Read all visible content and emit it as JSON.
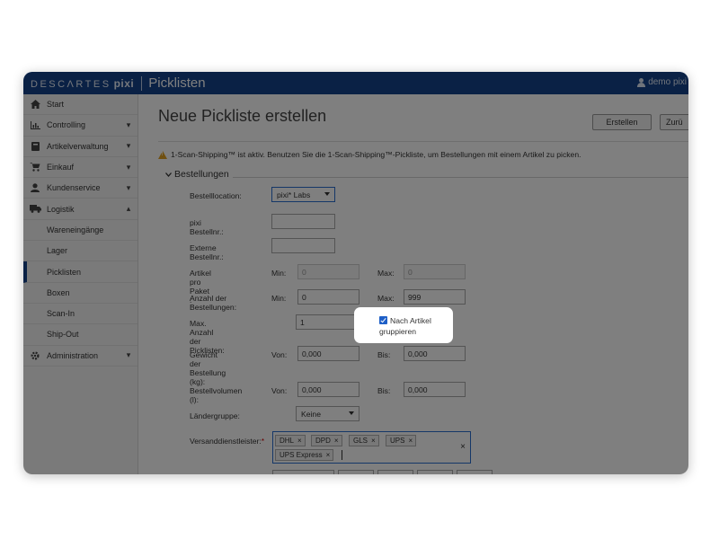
{
  "topbar": {
    "brand": "DESCΛRTES",
    "brand_pixi": "pixi",
    "app_title": "Picklisten",
    "user": "demo pixi"
  },
  "sidebar": {
    "items": [
      {
        "label": "Start",
        "icon": "home-icon",
        "chevron": ""
      },
      {
        "label": "Controlling",
        "icon": "bar-chart-icon",
        "chevron": "▾"
      },
      {
        "label": "Artikelverwaltung",
        "icon": "book-icon",
        "chevron": "▾"
      },
      {
        "label": "Einkauf",
        "icon": "cart-icon",
        "chevron": "▾"
      },
      {
        "label": "Kundenservice",
        "icon": "user-icon",
        "chevron": "▾"
      },
      {
        "label": "Logistik",
        "icon": "truck-icon",
        "chevron": "▴"
      },
      {
        "label": "Wareneingänge",
        "sub": true
      },
      {
        "label": "Lager",
        "sub": true
      },
      {
        "label": "Picklisten",
        "sub": true,
        "active": true
      },
      {
        "label": "Boxen",
        "sub": true
      },
      {
        "label": "Scan-In",
        "sub": true
      },
      {
        "label": "Ship-Out",
        "sub": true
      },
      {
        "label": "Administration",
        "icon": "gear-icon",
        "chevron": "▾"
      }
    ]
  },
  "main": {
    "title": "Neue Pickliste erstellen",
    "btn_create": "Erstellen",
    "btn_back": "Zurü",
    "warning": "1-Scan-Shipping™ ist aktiv. Benutzen Sie die 1-Scan-Shipping™-Pickliste, um Bestellungen mit einem Artikel zu picken.",
    "section_title": "Bestellungen"
  },
  "form": {
    "location_label": "Bestelllocation:",
    "location_value": "pixi* Labs",
    "pixi_nr_label": "pixi Bestellnr.:",
    "pixi_nr_value": "",
    "extern_nr_label": "Externe Bestellnr.:",
    "extern_nr_value": "",
    "articles_label": "Artikel pro Paket :",
    "articles_min_label": "Min:",
    "articles_min_value": "0",
    "articles_max_label": "Max:",
    "articles_max_value": "0",
    "orders_label": "Anzahl der Bestellungen:",
    "orders_min_label": "Min:",
    "orders_min_value": "0",
    "orders_max_label": "Max:",
    "orders_max_value": "999",
    "max_picklists_label": "Max. Anzahl der Picklisten:",
    "max_picklists_value": "1",
    "group_checkbox_label": "Nach Artikel gruppieren",
    "group_checked": true,
    "weight_label_1": "Gewicht der Bestellung",
    "weight_label_2": "(kg):",
    "weight_from_label": "Von:",
    "weight_from_value": "0,000",
    "weight_to_label": "Bis:",
    "weight_to_value": "0,000",
    "volume_label": "Bestellvolumen (l):",
    "volume_from_label": "Von:",
    "volume_from_value": "0,000",
    "volume_to_label": "Bis:",
    "volume_to_value": "0,000",
    "country_label": "Ländergruppe:",
    "country_value": "Keine",
    "shipping_label": "Versanddienstleister:",
    "shipping_required": "*",
    "shipping_tags": [
      "DHL",
      "DPD",
      "GLS",
      "UPS",
      "UPS Express"
    ],
    "tag_remove": "×",
    "clear": "×"
  }
}
